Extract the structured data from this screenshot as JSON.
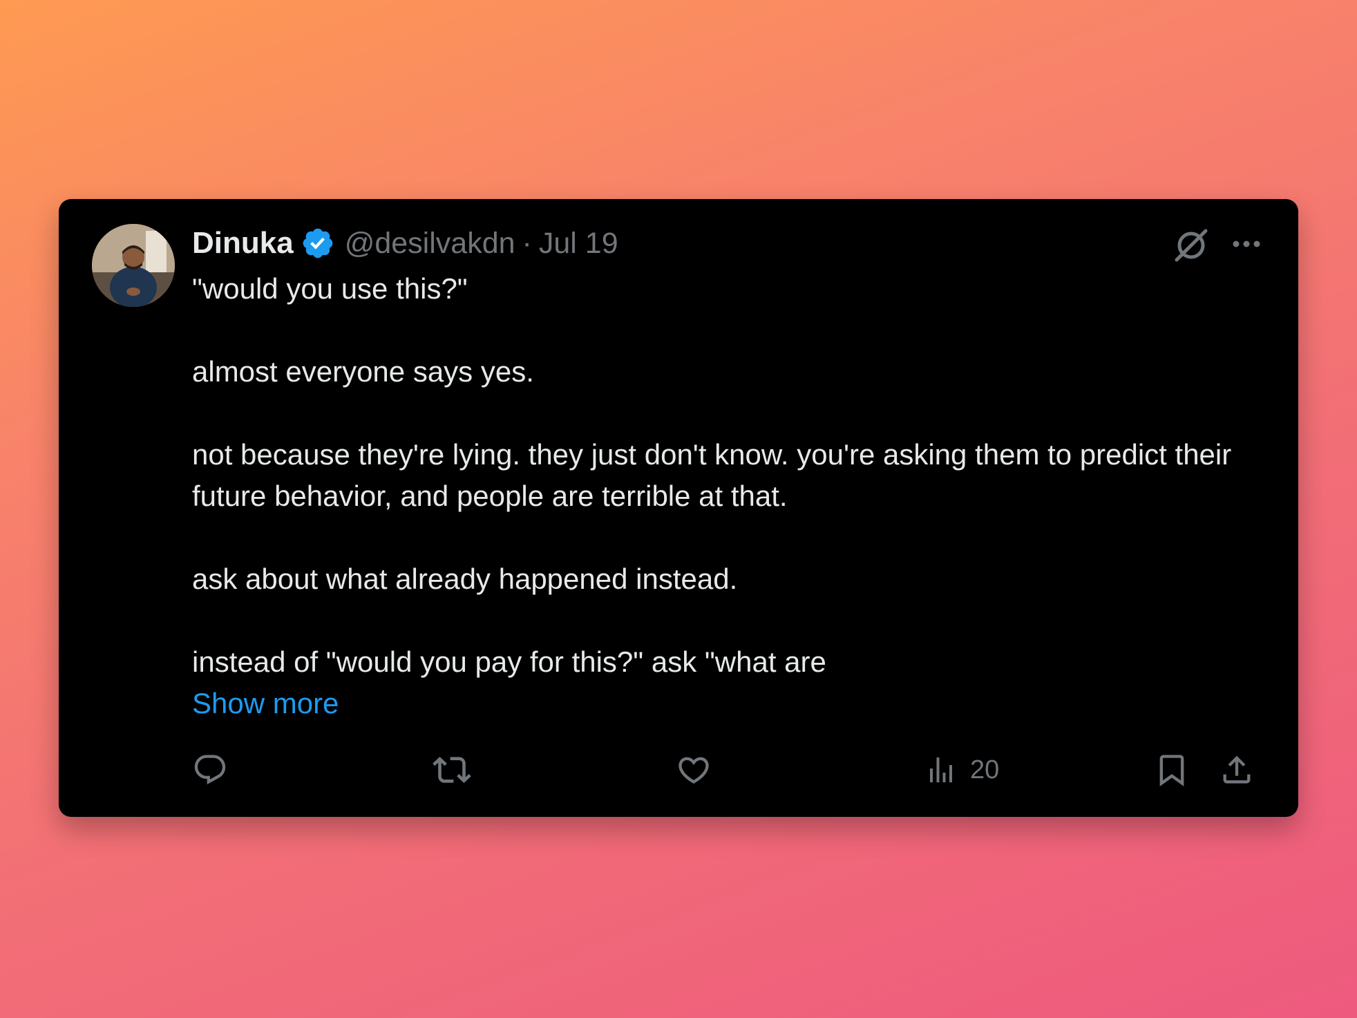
{
  "tweet": {
    "author_name": "Dinuka",
    "handle": "@desilvakdn",
    "separator": "·",
    "date": "Jul 19",
    "paragraphs": [
      "\"would you use this?\"",
      "almost everyone says yes.",
      "not because they're lying. they just don't know. you're asking them to predict their future behavior, and people are terrible at that.",
      "ask about what already happened instead.",
      "instead of \"would you pay for this?\" ask \"what are"
    ],
    "show_more_label": "Show more",
    "views_count": "20"
  },
  "colors": {
    "background_gradient": [
      "#fe9a52",
      "#f26f76",
      "#ee5a7e"
    ],
    "card": "#000000",
    "primary_text": "#e7e9ea",
    "secondary_text": "#71767b",
    "link": "#1d9bf0",
    "verified_badge": "#1d9bf0"
  },
  "icons": {
    "verified": "verified-badge-icon",
    "grok": "grok-icon",
    "more": "more-horizontal-icon",
    "reply": "reply-icon",
    "repost": "repost-icon",
    "like": "like-icon",
    "views": "views-icon",
    "bookmark": "bookmark-icon",
    "share": "share-icon"
  }
}
